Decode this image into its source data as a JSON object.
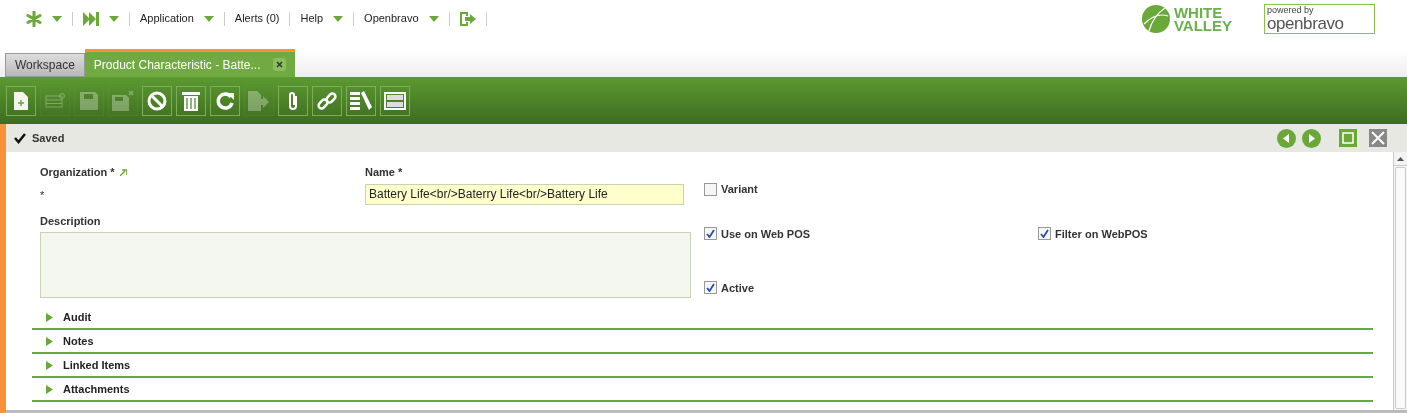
{
  "top_menu": [
    {
      "kind": "star",
      "has_dropdown": true
    },
    {
      "kind": "skip",
      "has_dropdown": true
    },
    {
      "kind": "text",
      "label": "Application",
      "has_dropdown": true
    },
    {
      "kind": "text",
      "label": "Alerts (0)",
      "has_dropdown": false
    },
    {
      "kind": "text",
      "label": "Help",
      "has_dropdown": true
    },
    {
      "kind": "text",
      "label": "Openbravo",
      "has_dropdown": true
    },
    {
      "kind": "logout",
      "has_dropdown": false
    }
  ],
  "logos": {
    "white_valley": [
      "WHITE",
      "VALLEY"
    ],
    "powered_by": "powered by",
    "openbravo": "openbravo"
  },
  "tabs": [
    {
      "label": "Workspace",
      "selected": false,
      "closable": false
    },
    {
      "label": "Product Characteristic - Batte...",
      "selected": true,
      "closable": true
    }
  ],
  "toolbar": [
    {
      "kind": "new",
      "disabled": false
    },
    {
      "kind": "grid",
      "disabled": true
    },
    {
      "kind": "save",
      "disabled": true
    },
    {
      "kind": "save-close",
      "disabled": true
    },
    {
      "kind": "cancel",
      "disabled": false
    },
    {
      "kind": "delete",
      "disabled": false
    },
    {
      "kind": "refresh",
      "disabled": false
    },
    {
      "kind": "export",
      "disabled": true
    },
    {
      "kind": "attach",
      "disabled": false
    },
    {
      "kind": "link",
      "disabled": false
    },
    {
      "kind": "tools",
      "disabled": false
    },
    {
      "kind": "layout",
      "disabled": false
    }
  ],
  "status": {
    "message": "Saved"
  },
  "form": {
    "organization": {
      "label": "Organization *",
      "value": "*"
    },
    "name": {
      "label": "Name *",
      "value": "Battery Life<br/>Baterry Life<br/>Battery Life"
    },
    "description": {
      "label": "Description"
    },
    "checkboxes": [
      {
        "label": "Variant",
        "checked": false
      },
      {
        "label": "Use on Web POS",
        "checked": true
      },
      {
        "label": "Filter on WebPOS",
        "checked": true
      },
      {
        "label": "Active",
        "checked": true
      }
    ]
  },
  "sections": [
    {
      "label": "Audit",
      "expanded": false
    },
    {
      "label": "Notes",
      "expanded": false
    },
    {
      "label": "Linked Items",
      "expanded": false
    },
    {
      "label": "Attachments",
      "expanded": false
    }
  ]
}
